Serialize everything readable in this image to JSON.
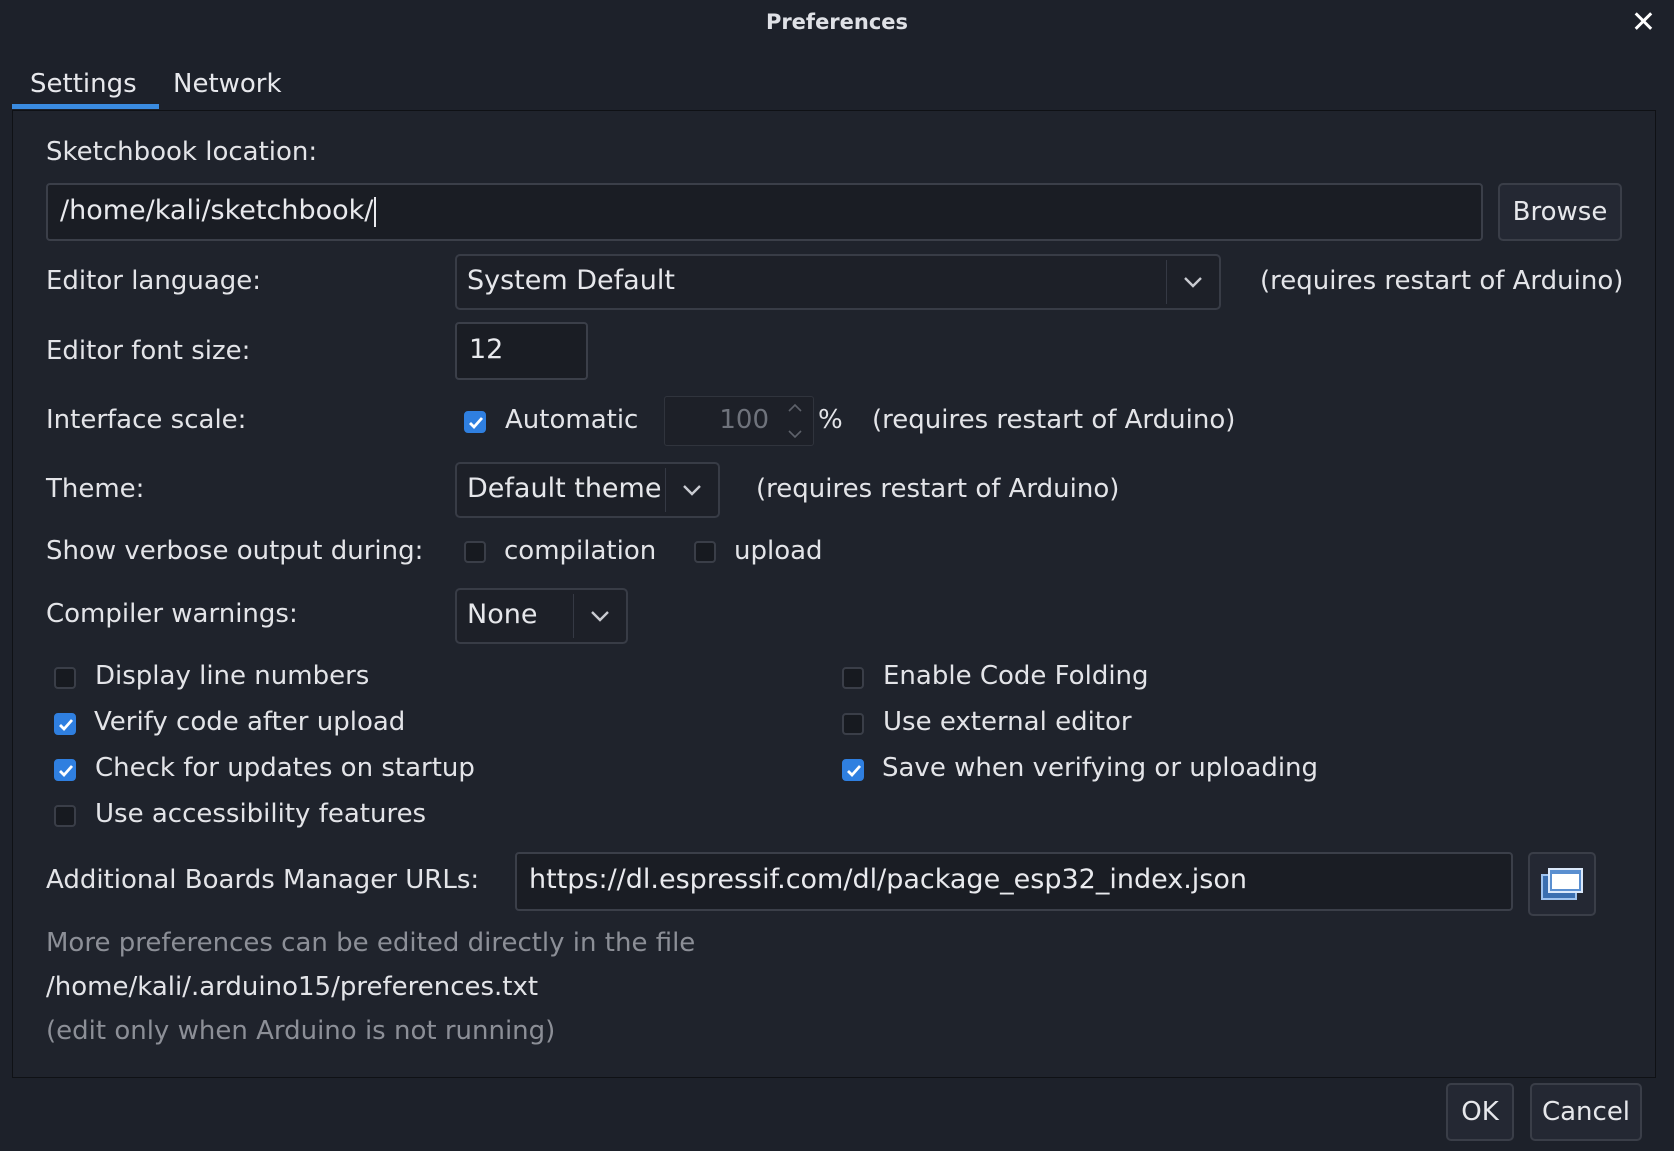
{
  "window": {
    "title": "Preferences"
  },
  "tabs": [
    {
      "label": "Settings"
    },
    {
      "label": "Network"
    }
  ],
  "sketchbook": {
    "label": "Sketchbook location:",
    "value": "/home/kali/sketchbook/",
    "browse": "Browse"
  },
  "editor_language": {
    "label": "Editor language:",
    "value": "System Default",
    "note": "(requires restart of Arduino)"
  },
  "editor_font_size": {
    "label": "Editor font size:",
    "value": "12"
  },
  "interface_scale": {
    "label": "Interface scale:",
    "auto_label": "Automatic",
    "auto_checked": true,
    "value": "100",
    "unit": "%",
    "note": "(requires restart of Arduino)"
  },
  "theme": {
    "label": "Theme:",
    "value": "Default theme",
    "note": "(requires restart of Arduino)"
  },
  "verbose": {
    "label": "Show verbose output during:",
    "compilation": "compilation",
    "compilation_checked": false,
    "upload": "upload",
    "upload_checked": false
  },
  "compiler_warnings": {
    "label": "Compiler warnings:",
    "value": "None"
  },
  "options_left": [
    {
      "label": "Display line numbers",
      "checked": false
    },
    {
      "label": "Verify code after upload",
      "checked": true
    },
    {
      "label": "Check for updates on startup",
      "checked": true
    },
    {
      "label": "Use accessibility features",
      "checked": false
    }
  ],
  "options_right": [
    {
      "label": "Enable Code Folding",
      "checked": false
    },
    {
      "label": "Use external editor",
      "checked": false
    },
    {
      "label": "Save when verifying or uploading",
      "checked": true
    }
  ],
  "boards_urls": {
    "label": "Additional Boards Manager URLs:",
    "value": "https://dl.espressif.com/dl/package_esp32_index.json"
  },
  "footer_text": {
    "line1": "More preferences can be edited directly in the file",
    "path": "/home/kali/.arduino15/preferences.txt",
    "line3": "(edit only when Arduino is not running)"
  },
  "buttons": {
    "ok": "OK",
    "cancel": "Cancel"
  },
  "colors": {
    "background": "#1d212a",
    "accent": "#2f7fe0"
  }
}
